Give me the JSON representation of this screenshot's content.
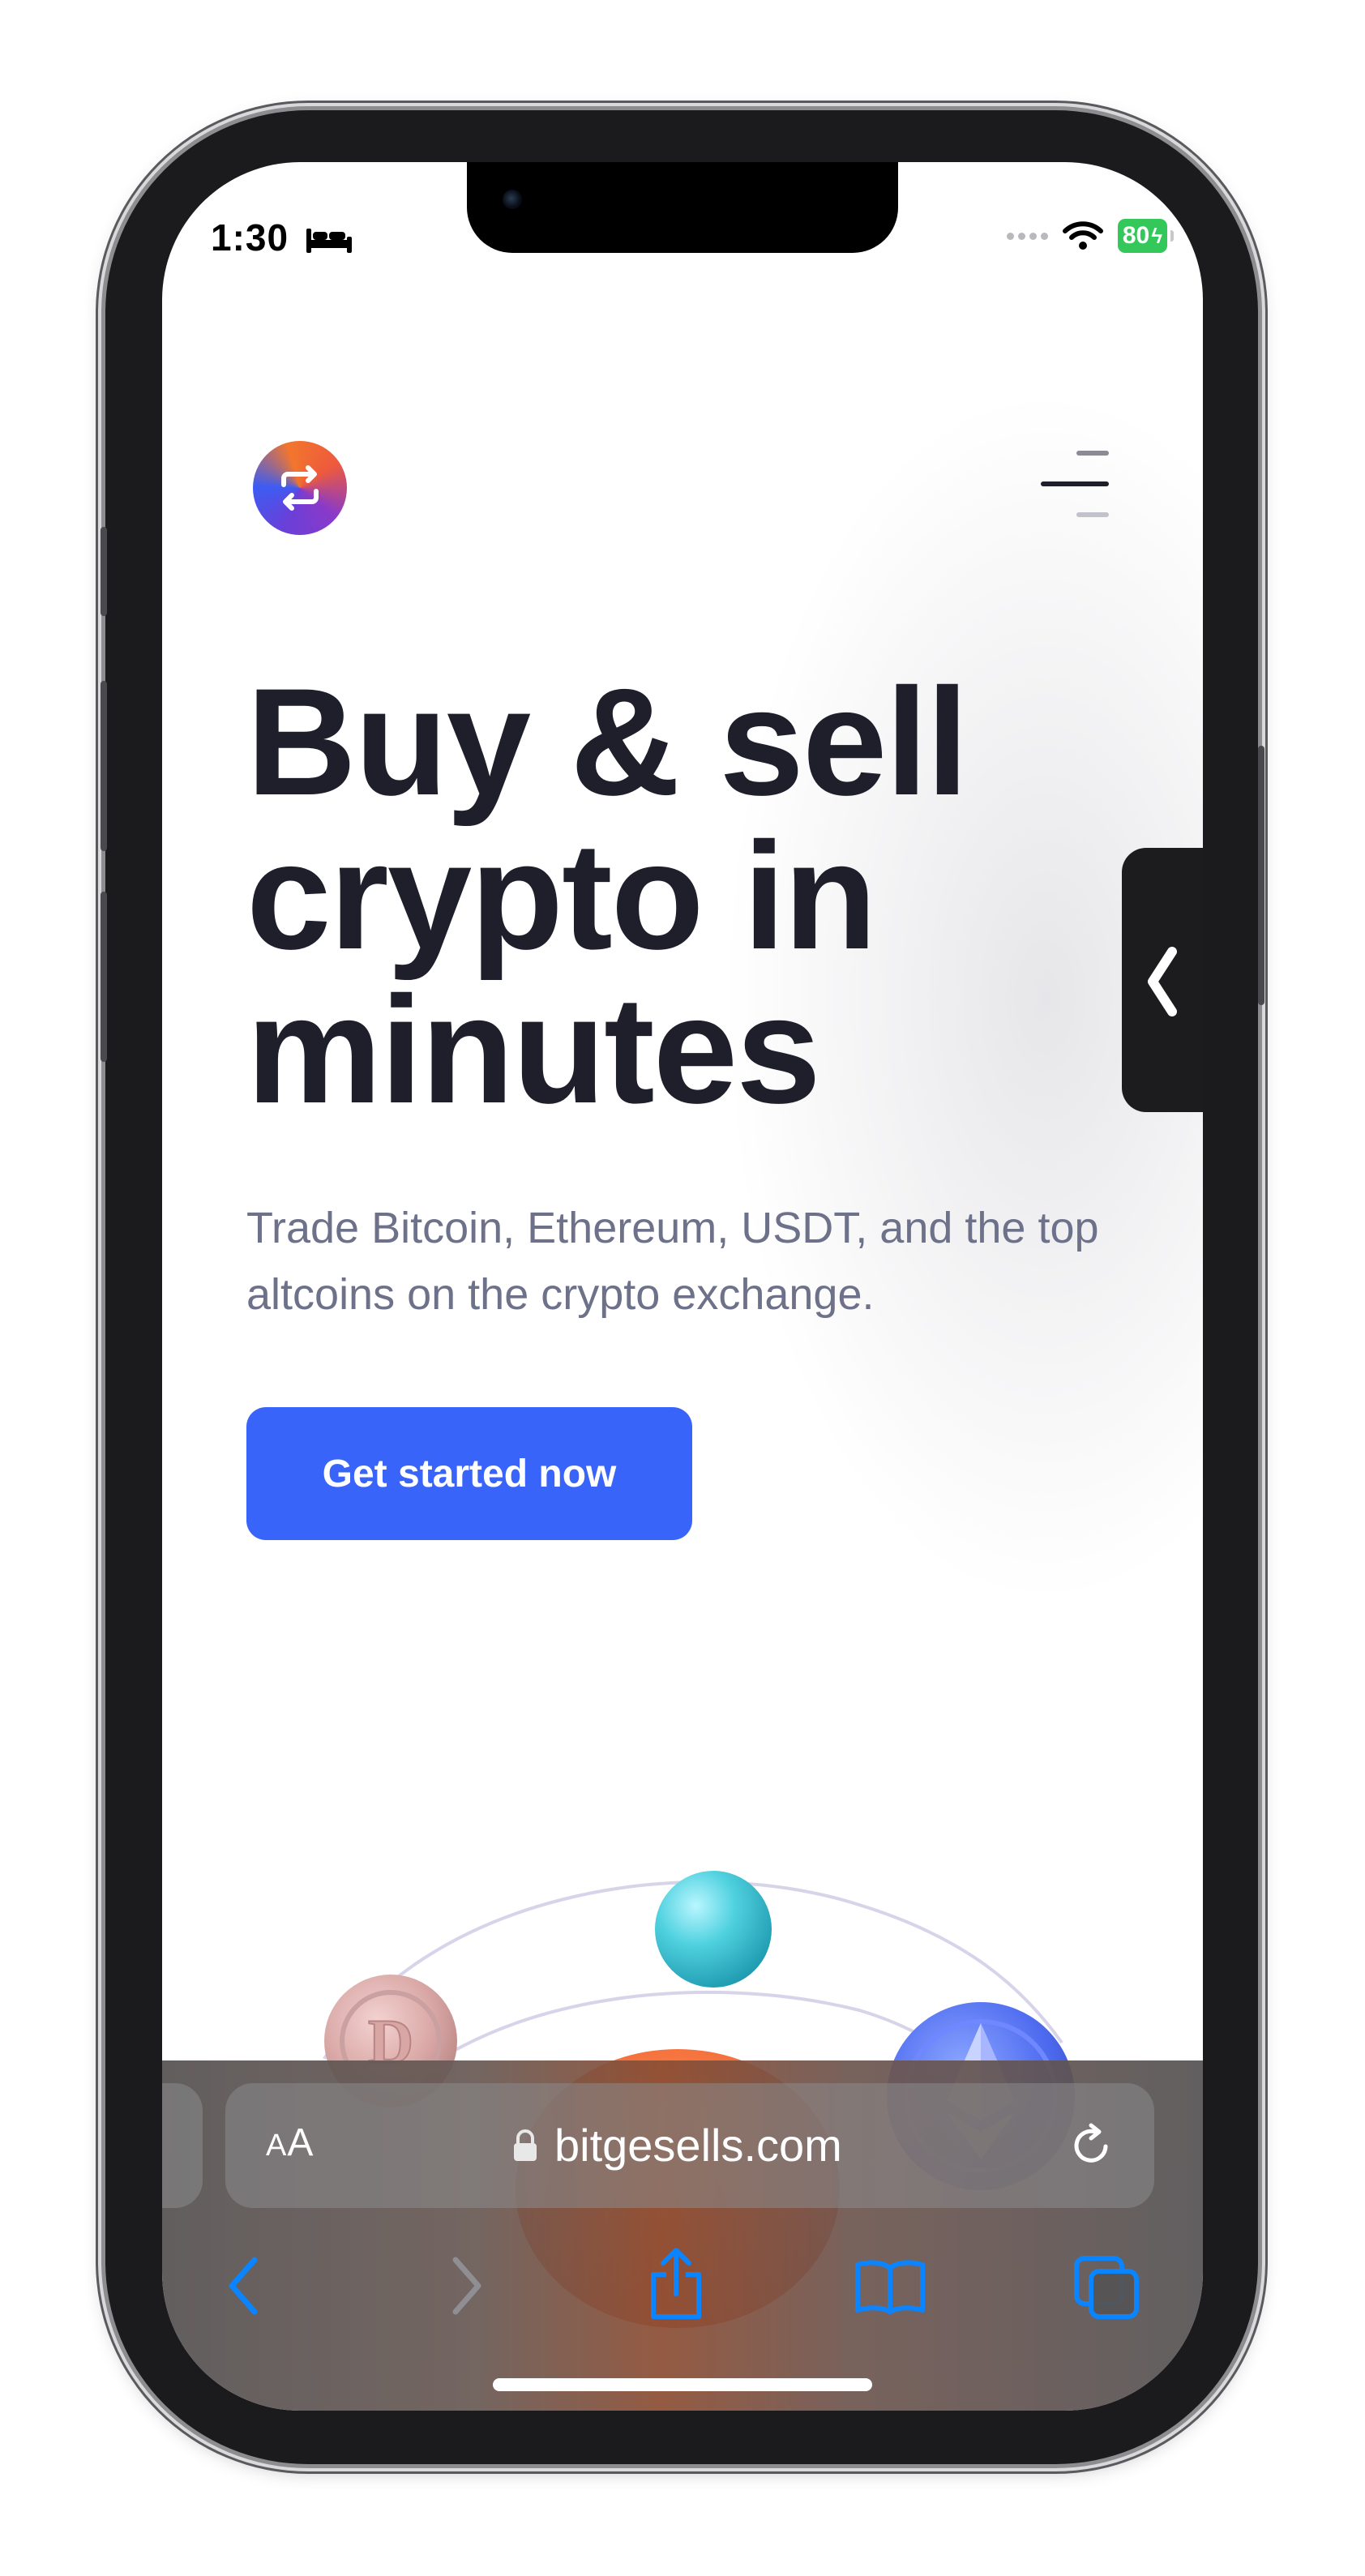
{
  "status_bar": {
    "time": "1:30",
    "battery": "80"
  },
  "header": {
    "logo_icon": "exchange-arrows-icon",
    "menu_icon": "hamburger-menu-icon"
  },
  "hero": {
    "title": "Buy & sell crypto in minutes",
    "subtitle": "Trade Bitcoin, Ethereum, USDT, and the top altcoins on the crypto exchange.",
    "cta_label": "Get started now"
  },
  "side_tab": {
    "icon": "chevron-left-icon"
  },
  "coins": [
    "dogecoin-coin",
    "teal-sphere",
    "ethereum-coin",
    "orange-planet"
  ],
  "safari": {
    "aa_small": "A",
    "aa_large": "A",
    "url": "bitgesells.com",
    "icons": [
      "back-icon",
      "forward-icon",
      "share-icon",
      "bookmarks-icon",
      "tabs-icon"
    ]
  },
  "colors": {
    "primary_button": "#3964fa",
    "title_text": "#1e1f2b",
    "subtitle_text": "#6d7189",
    "safari_accent": "#0a84ff",
    "battery": "#34c759"
  }
}
